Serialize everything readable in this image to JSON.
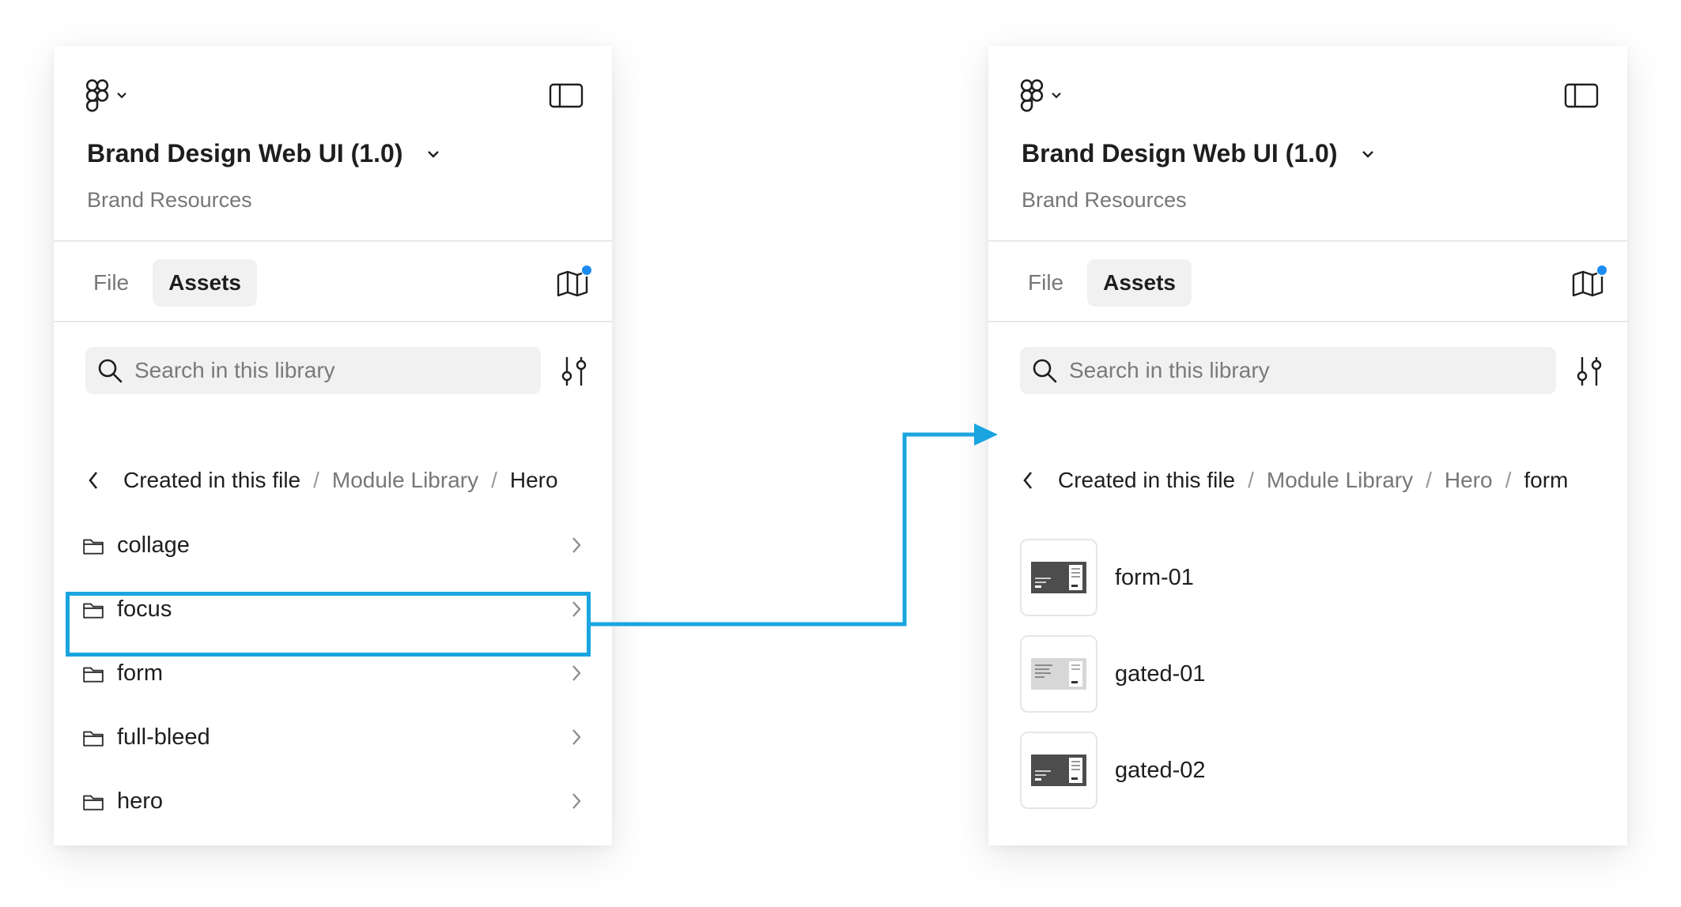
{
  "accent_color": "#1aa5e0",
  "left_panel": {
    "file_title": "Brand Design Web UI (1.0)",
    "subtitle": "Brand Resources",
    "tabs": [
      {
        "label": "File"
      },
      {
        "label": "Assets"
      }
    ],
    "active_tab": "Assets",
    "search": {
      "placeholder": "Search in this library"
    },
    "breadcrumb": [
      "Created in this file",
      "Module Library",
      "Hero"
    ],
    "folders": [
      {
        "name": "collage"
      },
      {
        "name": "focus"
      },
      {
        "name": "form"
      },
      {
        "name": "full-bleed"
      },
      {
        "name": "hero"
      }
    ],
    "highlighted_folder": "form"
  },
  "right_panel": {
    "file_title": "Brand Design Web UI (1.0)",
    "subtitle": "Brand Resources",
    "tabs": [
      {
        "label": "File"
      },
      {
        "label": "Assets"
      }
    ],
    "active_tab": "Assets",
    "search": {
      "placeholder": "Search in this library"
    },
    "breadcrumb": [
      "Created in this file",
      "Module Library",
      "Hero",
      "form"
    ],
    "assets": [
      {
        "name": "form-01"
      },
      {
        "name": "gated-01"
      },
      {
        "name": "gated-02"
      }
    ]
  }
}
